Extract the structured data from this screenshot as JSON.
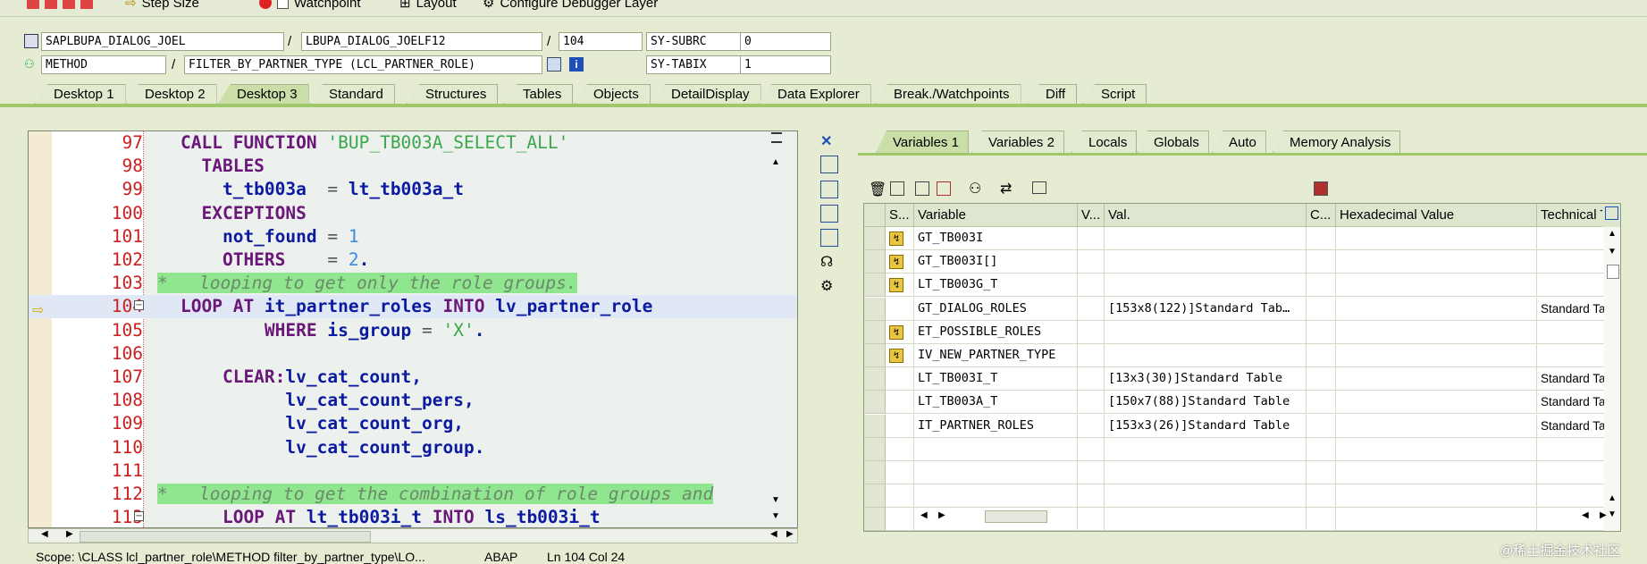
{
  "toolbar": {
    "step_size": "Step Size",
    "watchpoint": "Watchpoint",
    "layout": "Layout",
    "configure": "Configure Debugger Layer"
  },
  "info": {
    "program": "SAPLBUPA_DIALOG_JOEL",
    "include": "LBUPA_DIALOG_JOELF12",
    "line": "104",
    "subrc_label": "SY-SUBRC",
    "subrc_value": "0",
    "event_type": "METHOD",
    "event": "FILTER_BY_PARTNER_TYPE (LCL_PARTNER_ROLE)",
    "tabix_label": "SY-TABIX",
    "tabix_value": "1",
    "slash": "/"
  },
  "tabs": [
    "Desktop 1",
    "Desktop 2",
    "Desktop 3",
    "Standard",
    "Structures",
    "Tables",
    "Objects",
    "DetailDisplay",
    "Data Explorer",
    "Break./Watchpoints",
    "Diff",
    "Script"
  ],
  "code": [
    {
      "n": "97",
      "segs": [
        [
          "kw",
          "CALL FUNCTION "
        ],
        [
          "str",
          "'BUP_TB003A_SELECT_ALL'"
        ]
      ]
    },
    {
      "n": "98",
      "segs": [
        [
          "kw",
          "  TABLES"
        ]
      ]
    },
    {
      "n": "99",
      "segs": [
        [
          "id",
          "    t_tb003a  "
        ],
        [
          "op",
          "= "
        ],
        [
          "id",
          "lt_tb003a_t"
        ]
      ]
    },
    {
      "n": "100",
      "segs": [
        [
          "kw",
          "  EXCEPTIONS"
        ]
      ]
    },
    {
      "n": "101",
      "segs": [
        [
          "id",
          "    not_found "
        ],
        [
          "op",
          "= "
        ],
        [
          "num",
          "1"
        ]
      ]
    },
    {
      "n": "102",
      "segs": [
        [
          "kw",
          "    OTHERS    "
        ],
        [
          "op",
          "= "
        ],
        [
          "num",
          "2"
        ],
        [
          "id",
          "."
        ]
      ]
    },
    {
      "n": "103",
      "segs": [
        [
          "cmt",
          "*   looping to get only the role groups."
        ]
      ]
    },
    {
      "n": "104",
      "segs": [
        [
          "kw",
          "LOOP AT "
        ],
        [
          "id",
          "it_partner_roles "
        ],
        [
          "kw",
          "INTO "
        ],
        [
          "id",
          "lv_partner_role"
        ]
      ]
    },
    {
      "n": "105",
      "segs": [
        [
          "kw",
          "        WHERE "
        ],
        [
          "id",
          "is_group "
        ],
        [
          "op",
          "= "
        ],
        [
          "str",
          "'X'"
        ],
        [
          "id",
          "."
        ]
      ]
    },
    {
      "n": "106",
      "segs": []
    },
    {
      "n": "107",
      "segs": [
        [
          "kw",
          "    CLEAR:"
        ],
        [
          "id",
          "lv_cat_count,"
        ]
      ]
    },
    {
      "n": "108",
      "segs": [
        [
          "id",
          "          lv_cat_count_pers,"
        ]
      ]
    },
    {
      "n": "109",
      "segs": [
        [
          "id",
          "          lv_cat_count_org,"
        ]
      ]
    },
    {
      "n": "110",
      "segs": [
        [
          "id",
          "          lv_cat_count_group."
        ]
      ]
    },
    {
      "n": "111",
      "segs": []
    },
    {
      "n": "112",
      "segs": [
        [
          "cmt",
          "*   looping to get the combination of role groups and"
        ]
      ]
    },
    {
      "n": "113",
      "segs": [
        [
          "kw",
          "    LOOP AT "
        ],
        [
          "id",
          "lt_tb003i_t "
        ],
        [
          "kw",
          "INTO "
        ],
        [
          "id",
          "ls_tb003i_t"
        ]
      ]
    }
  ],
  "var_tabs": [
    "Variables 1",
    "Variables 2",
    "Locals",
    "Globals",
    "Auto",
    "Memory Analysis"
  ],
  "grid": {
    "headers": [
      "S...",
      "Variable",
      "V...",
      "Val.",
      "C...",
      "Hexadecimal Value",
      "Technical Ty"
    ],
    "rows": [
      {
        "icon": true,
        "variable": "GT_TB003I",
        "value": "",
        "tech": ""
      },
      {
        "icon": true,
        "variable": "GT_TB003I[]",
        "value": "",
        "tech": ""
      },
      {
        "icon": true,
        "variable": "LT_TB003G_T",
        "value": "",
        "tech": ""
      },
      {
        "icon": false,
        "variable": "GT_DIALOG_ROLES",
        "value": "[153x8(122)]Standard Tab…",
        "tech": "Standard Tal"
      },
      {
        "icon": true,
        "variable": "ET_POSSIBLE_ROLES",
        "value": "",
        "tech": ""
      },
      {
        "icon": true,
        "variable": "IV_NEW_PARTNER_TYPE",
        "value": "",
        "tech": ""
      },
      {
        "icon": false,
        "variable": "LT_TB003I_T",
        "value": "[13x3(30)]Standard Table",
        "tech": "Standard Tal"
      },
      {
        "icon": false,
        "variable": "LT_TB003A_T",
        "value": "[150x7(88)]Standard Table",
        "tech": "Standard Tal"
      },
      {
        "icon": false,
        "variable": "IT_PARTNER_ROLES",
        "value": "[153x3(26)]Standard Table",
        "tech": "Standard Tal"
      },
      {
        "icon": false,
        "variable": "",
        "value": "",
        "tech": ""
      },
      {
        "icon": false,
        "variable": "",
        "value": "",
        "tech": ""
      },
      {
        "icon": false,
        "variable": "",
        "value": "",
        "tech": ""
      },
      {
        "icon": false,
        "variable": "",
        "value": "",
        "tech": ""
      }
    ]
  },
  "status": {
    "scope": "Scope: \\CLASS lcl_partner_role\\METHOD filter_by_partner_type\\LO...",
    "lang": "ABAP",
    "pos": "Ln 104 Col  24"
  },
  "watermark": "@稀土掘金技术社区",
  "colors": {
    "accent": "#c9dfa7",
    "comment_bg": "#8fe68f",
    "line_numbers": "#cc1f1f",
    "keyword": "#6b1779",
    "identifier": "#0b1aa0"
  }
}
